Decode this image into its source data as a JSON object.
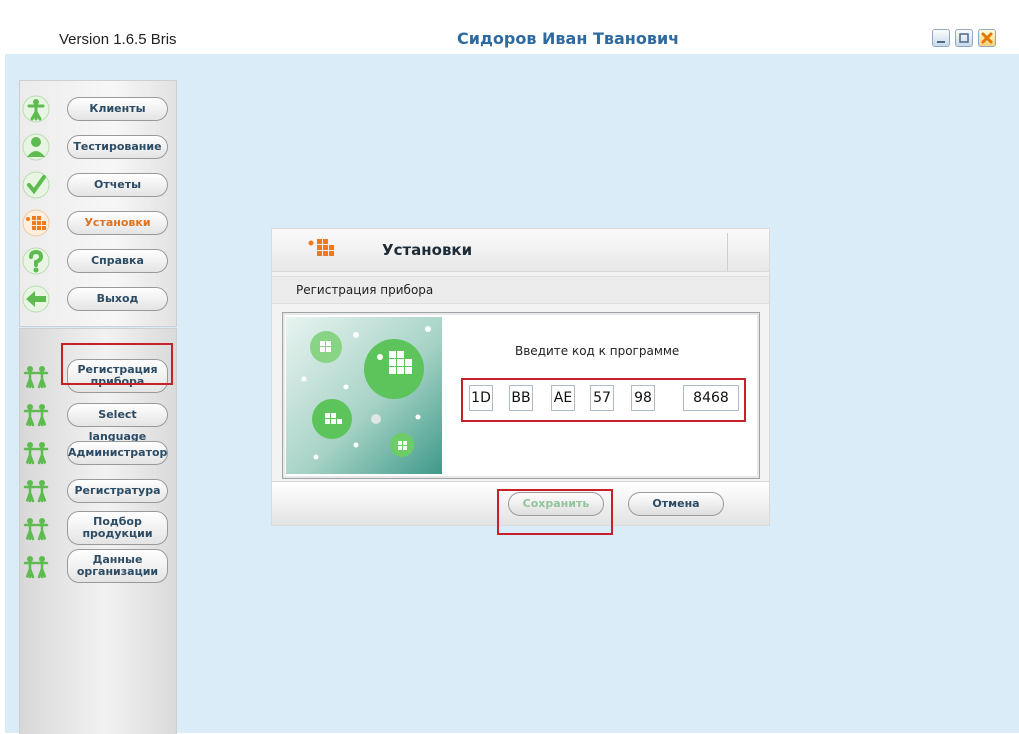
{
  "app": {
    "version": "Version 1.6.5 Bris",
    "user": "Сидоров Иван Тванович"
  },
  "window_controls": {
    "min_icon": "minimize-icon",
    "max_icon": "maximize-icon",
    "close_icon": "close-icon"
  },
  "nav_main": [
    {
      "label": "Клиенты",
      "icon": "person-icon",
      "color": "#5dbb4f"
    },
    {
      "label": "Тестирование",
      "icon": "user-icon",
      "color": "#5dbb4f"
    },
    {
      "label": "Отчеты",
      "icon": "checkmark-icon",
      "color": "#5dbb4f"
    },
    {
      "label": "Установки",
      "icon": "settings-grid-icon",
      "color": "#f07a1a",
      "active": true
    },
    {
      "label": "Справка",
      "icon": "help-icon",
      "color": "#5dbb4f"
    },
    {
      "label": "Выход",
      "icon": "exit-arrow-icon",
      "color": "#5dbb4f"
    }
  ],
  "nav_settings": [
    {
      "label": "Регистрация прибора",
      "icon": "people-icon"
    },
    {
      "label": "Select language",
      "icon": "people-icon"
    },
    {
      "label": "Администратор",
      "icon": "people-icon"
    },
    {
      "label": "Регистратура",
      "icon": "people-icon"
    },
    {
      "label": "Подбор продукции",
      "icon": "people-icon"
    },
    {
      "label": "Данные организации",
      "icon": "people-icon"
    }
  ],
  "dialog": {
    "title": "Установки",
    "subtitle": "Регистрация прибора",
    "prompt": "Введите код к программе",
    "code_fields": [
      "1D",
      "BB",
      "AE",
      "57",
      "98",
      "8468"
    ],
    "save_label": "Сохранить",
    "cancel_label": "Отмена"
  },
  "colors": {
    "accent_orange": "#f07a1a",
    "accent_green": "#5dbb4f",
    "highlight_red": "#c8202a",
    "background": "#d9ecf8"
  }
}
